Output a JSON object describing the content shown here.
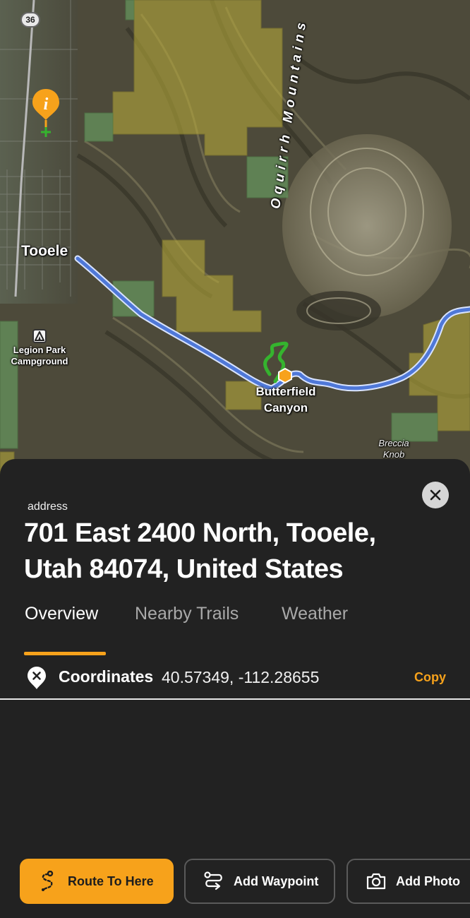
{
  "map": {
    "road_shield": "36",
    "labels": {
      "tooele": "Tooele",
      "oquirrh": "Oquirrh Mountains",
      "legion_line1": "Legion Park",
      "legion_line2": "Campground",
      "butterfield_line1": "Butterfield",
      "butterfield_line2": "Canyon",
      "breccia_line1": "Breccia",
      "breccia_line2": "Knob"
    },
    "icons": [
      "info-pin-icon",
      "campground-icon",
      "trailhead-marker-icon"
    ],
    "route_color": "#4f78d8",
    "trail_color": "#35b42e",
    "public_land_color": "#b5a83a"
  },
  "sheet": {
    "type_label": "address",
    "address_line1": "701 East 2400 North, Tooele,",
    "address_line2": "Utah 84074, United States",
    "close_icon": "close-icon",
    "tabs": [
      {
        "label": "Overview",
        "active": true
      },
      {
        "label": "Nearby Trails",
        "active": false
      },
      {
        "label": "Weather",
        "active": false
      }
    ],
    "coordinates": {
      "icon": "location-pin-x-icon",
      "label": "Coordinates",
      "value": "40.57349, -112.28655",
      "copy_label": "Copy"
    },
    "actions": [
      {
        "label": "Route To Here",
        "icon": "route-icon"
      },
      {
        "label": "Add Waypoint",
        "icon": "waypoint-icon"
      },
      {
        "label": "Add Photo",
        "icon": "camera-icon"
      }
    ],
    "accent_color": "#f7a21b"
  }
}
